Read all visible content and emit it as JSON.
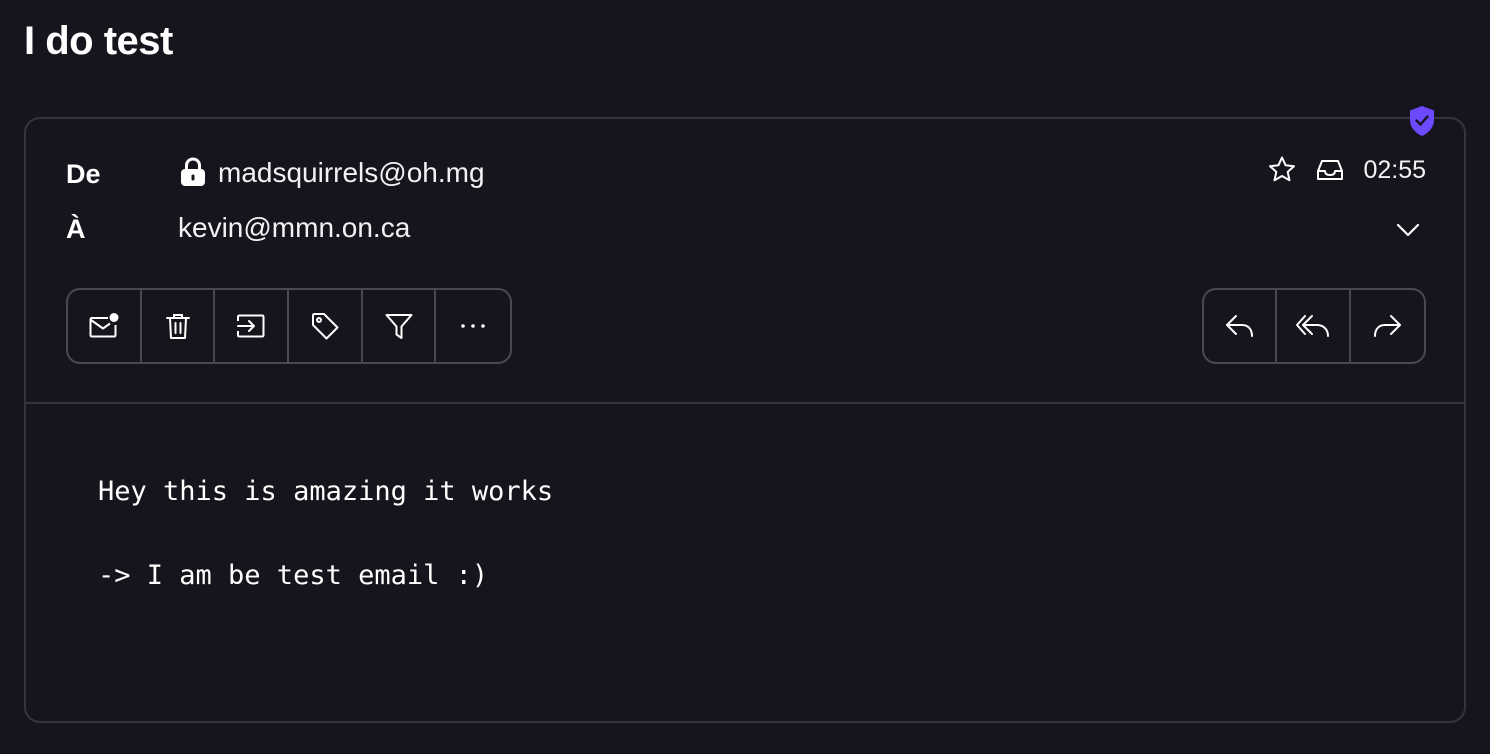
{
  "subject": "I do test",
  "header": {
    "from_label": "De",
    "from_address": "madsquirrels@oh.mg",
    "to_label": "À",
    "to_address": "kevin@mmn.on.ca",
    "time": "02:55"
  },
  "icons": {
    "verified": "shield-check-icon",
    "encrypted": "lock-icon",
    "star": "star-icon",
    "location": "inbox-icon",
    "expand": "chevron-down-icon"
  },
  "actions_left": [
    {
      "name": "mark-unread",
      "icon": "envelope-dot-icon"
    },
    {
      "name": "delete",
      "icon": "trash-icon"
    },
    {
      "name": "move",
      "icon": "move-to-folder-icon"
    },
    {
      "name": "label",
      "icon": "tag-icon"
    },
    {
      "name": "filter",
      "icon": "filter-icon"
    },
    {
      "name": "more",
      "icon": "more-dots-icon"
    }
  ],
  "actions_right": [
    {
      "name": "reply",
      "icon": "reply-icon"
    },
    {
      "name": "reply-all",
      "icon": "reply-all-icon"
    },
    {
      "name": "forward",
      "icon": "forward-icon"
    }
  ],
  "body": {
    "line1": "Hey this is amazing it works",
    "line2": "-> I am be test email :)"
  },
  "colors": {
    "background": "#16141d",
    "border": "#35333c",
    "accent": "#6d4aff",
    "text": "#ffffff"
  }
}
